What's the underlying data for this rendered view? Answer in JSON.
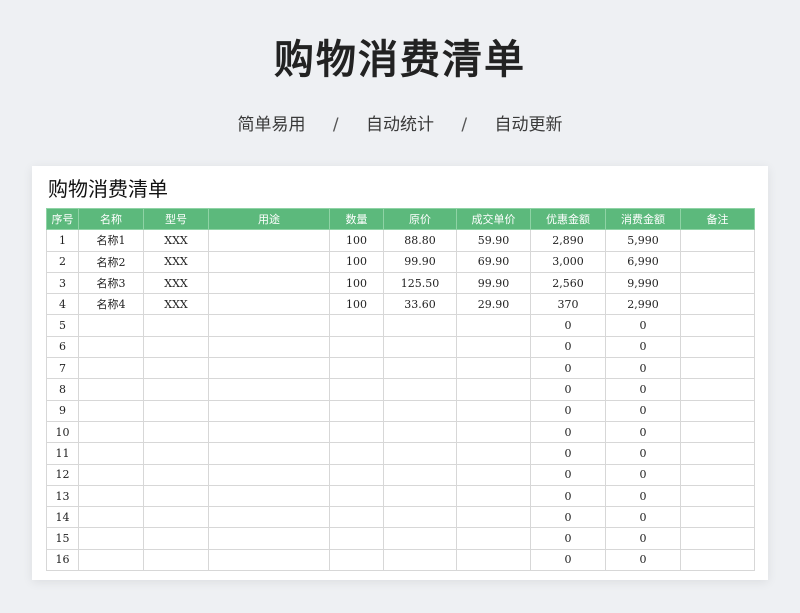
{
  "page": {
    "title": "购物消费清单",
    "tagline": [
      "简单易用",
      "自动统计",
      "自动更新"
    ],
    "tagline_separator": "/"
  },
  "sheet": {
    "title": "购物消费清单",
    "columns": [
      "序号",
      "名称",
      "型号",
      "用途",
      "数量",
      "原价",
      "成交单价",
      "优惠金额",
      "消费金额",
      "备注"
    ],
    "rows": [
      [
        "1",
        "名称1",
        "XXX",
        "",
        "100",
        "88.80",
        "59.90",
        "2,890",
        "5,990",
        ""
      ],
      [
        "2",
        "名称2",
        "XXX",
        "",
        "100",
        "99.90",
        "69.90",
        "3,000",
        "6,990",
        ""
      ],
      [
        "3",
        "名称3",
        "XXX",
        "",
        "100",
        "125.50",
        "99.90",
        "2,560",
        "9,990",
        ""
      ],
      [
        "4",
        "名称4",
        "XXX",
        "",
        "100",
        "33.60",
        "29.90",
        "370",
        "2,990",
        ""
      ],
      [
        "5",
        "",
        "",
        "",
        "",
        "",
        "",
        "0",
        "0",
        ""
      ],
      [
        "6",
        "",
        "",
        "",
        "",
        "",
        "",
        "0",
        "0",
        ""
      ],
      [
        "7",
        "",
        "",
        "",
        "",
        "",
        "",
        "0",
        "0",
        ""
      ],
      [
        "8",
        "",
        "",
        "",
        "",
        "",
        "",
        "0",
        "0",
        ""
      ],
      [
        "9",
        "",
        "",
        "",
        "",
        "",
        "",
        "0",
        "0",
        ""
      ],
      [
        "10",
        "",
        "",
        "",
        "",
        "",
        "",
        "0",
        "0",
        ""
      ],
      [
        "11",
        "",
        "",
        "",
        "",
        "",
        "",
        "0",
        "0",
        ""
      ],
      [
        "12",
        "",
        "",
        "",
        "",
        "",
        "",
        "0",
        "0",
        ""
      ],
      [
        "13",
        "",
        "",
        "",
        "",
        "",
        "",
        "0",
        "0",
        ""
      ],
      [
        "14",
        "",
        "",
        "",
        "",
        "",
        "",
        "0",
        "0",
        ""
      ],
      [
        "15",
        "",
        "",
        "",
        "",
        "",
        "",
        "0",
        "0",
        ""
      ],
      [
        "16",
        "",
        "",
        "",
        "",
        "",
        "",
        "0",
        "0",
        ""
      ]
    ]
  },
  "colors": {
    "header_bg": "#5cb97c",
    "header_text": "#ffffff",
    "page_bg": "#eef0f3"
  }
}
